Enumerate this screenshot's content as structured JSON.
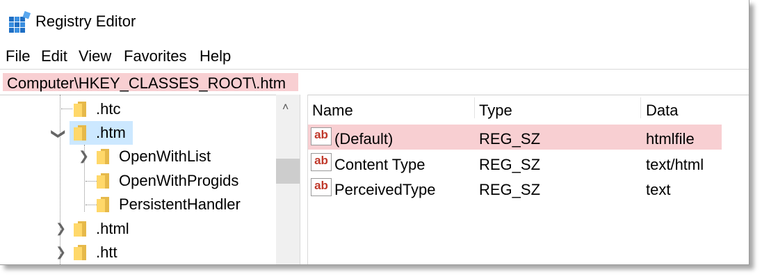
{
  "window": {
    "title": "Registry Editor"
  },
  "menu": [
    "File",
    "Edit",
    "View",
    "Favorites",
    "Help"
  ],
  "address": "Computer\\HKEY_CLASSES_ROOT\\.htm",
  "tree": {
    "items": [
      {
        "label": ".htc",
        "expanded": false
      },
      {
        "label": ".htm",
        "expanded": true,
        "selected": true
      },
      {
        "label": "OpenWithList"
      },
      {
        "label": "OpenWithProgids"
      },
      {
        "label": "PersistentHandler"
      },
      {
        "label": ".html"
      },
      {
        "label": ".htt"
      }
    ]
  },
  "list": {
    "columns": [
      "Name",
      "Type",
      "Data"
    ],
    "rows": [
      {
        "name": "(Default)",
        "type": "REG_SZ",
        "data": "htmlfile",
        "icon": "ab-string-icon"
      },
      {
        "name": "Content Type",
        "type": "REG_SZ",
        "data": "text/html",
        "icon": "ab-string-icon"
      },
      {
        "name": "PerceivedType",
        "type": "REG_SZ",
        "data": "text",
        "icon": "ab-string-icon"
      }
    ]
  },
  "colors": {
    "highlight": "#f8cfd2",
    "tree_selection": "#cce8ff",
    "folder": "#ffd86a"
  }
}
